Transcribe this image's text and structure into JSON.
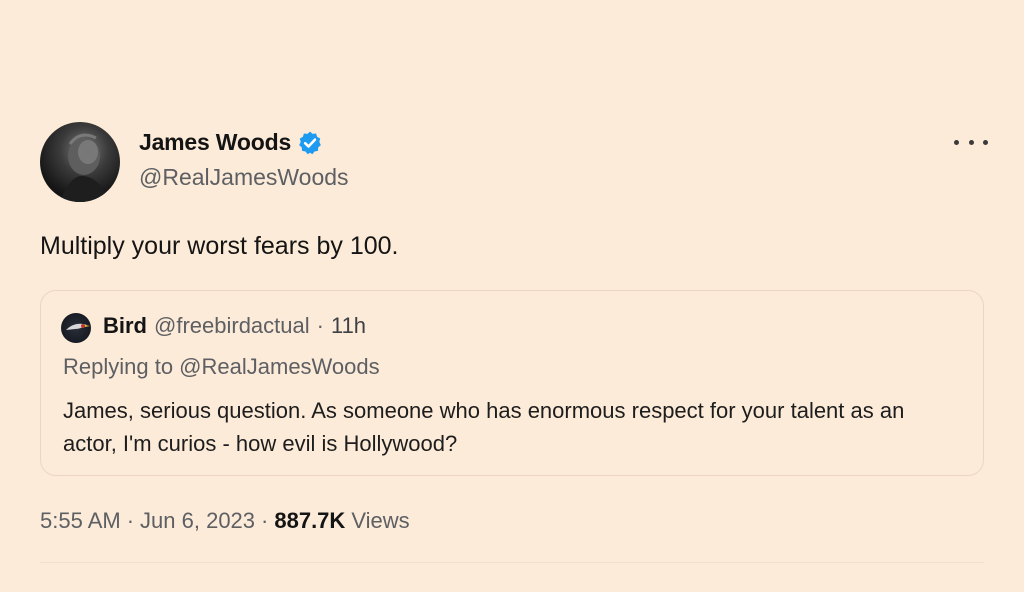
{
  "tweet": {
    "author_name": "James Woods",
    "author_handle": "@RealJamesWoods",
    "text": "Multiply your worst fears by 100.",
    "verified": true,
    "more_icon": "more-horizontal-icon"
  },
  "quote": {
    "author_name": "Bird",
    "author_handle": "@freebirdactual",
    "separator": "·",
    "time_ago": "11h",
    "replying_to": "Replying to @RealJamesWoods",
    "text": "James, serious question. As someone who has enormous respect for your talent as an actor, I'm curios - how evil is Hollywood?"
  },
  "meta": {
    "time": "5:55 AM",
    "sep1": "·",
    "date": "Jun 6, 2023",
    "sep2": "·",
    "views_count": "887.7K",
    "views_label": "Views"
  },
  "colors": {
    "background": "#fcebd9",
    "verified_badge": "#1d9bf0",
    "secondary_text": "#5d5f63"
  }
}
